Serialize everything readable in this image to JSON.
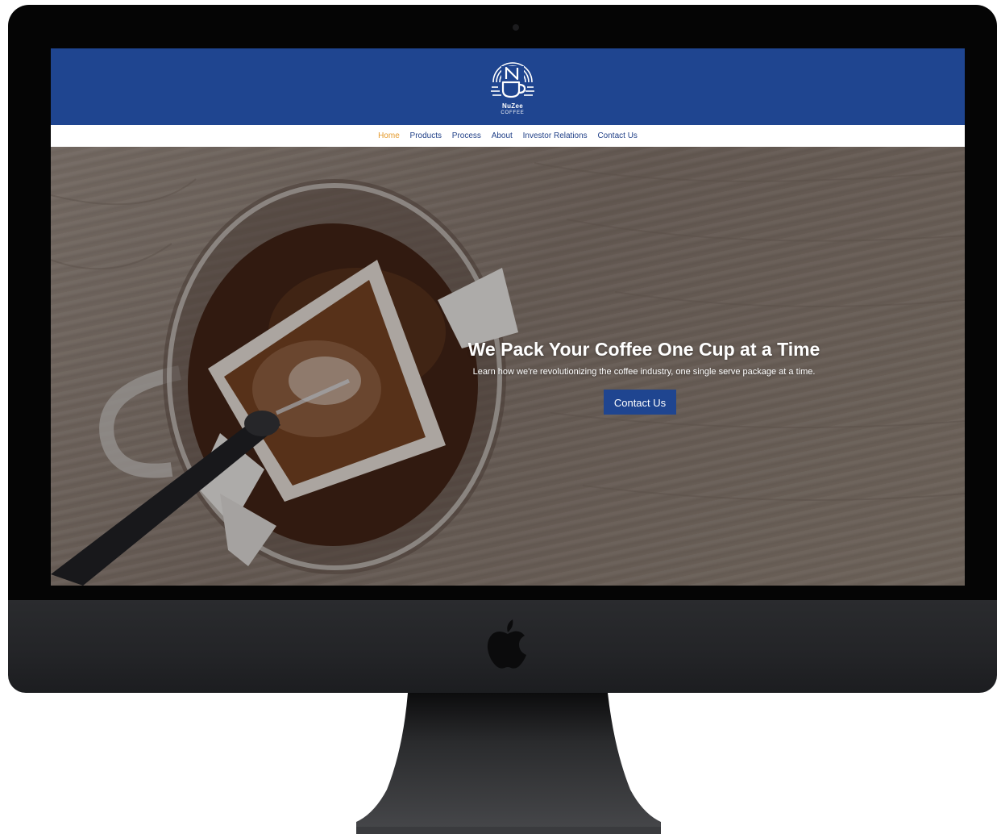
{
  "brand": {
    "name": "NuZee",
    "sub": "COFFEE"
  },
  "nav": {
    "items": [
      {
        "label": "Home",
        "active": true
      },
      {
        "label": "Products",
        "active": false
      },
      {
        "label": "Process",
        "active": false
      },
      {
        "label": "About",
        "active": false
      },
      {
        "label": "Investor Relations",
        "active": false
      },
      {
        "label": "Contact Us",
        "active": false
      }
    ]
  },
  "hero": {
    "title": "We Pack Your Coffee One Cup at a Time",
    "subtitle": "Learn how we're revolutionizing the coffee industry, one single serve package at a time.",
    "button_label": "Contact Us"
  },
  "colors": {
    "header_blue": "#1f4590",
    "nav_text": "#1f3f87",
    "nav_active": "#e59a2b",
    "device_frame": "#050505"
  },
  "icons": {
    "logo": "nuzee-cup-logo-icon",
    "device": "apple-logo-icon"
  }
}
